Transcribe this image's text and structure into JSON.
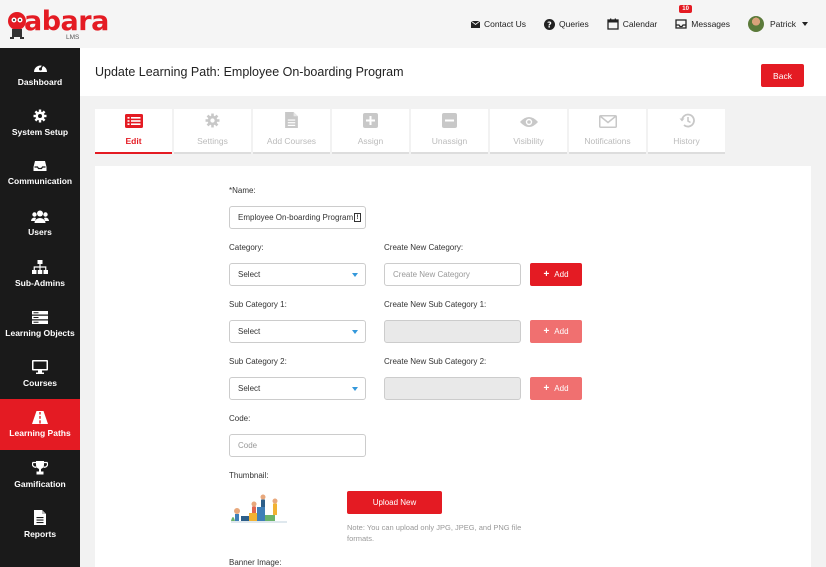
{
  "brand": {
    "name": "abara",
    "sub": "LMS"
  },
  "topnav": {
    "contact": "Contact Us",
    "queries": "Queries",
    "calendar": "Calendar",
    "messages": "Messages",
    "messages_count": "10",
    "user": "Patrick"
  },
  "sidebar": {
    "items": [
      {
        "label": "Dashboard",
        "icon": "dashboard-icon"
      },
      {
        "label": "System Setup",
        "icon": "gear-icon"
      },
      {
        "label": "Communication",
        "icon": "inbox-icon"
      },
      {
        "label": "Users",
        "icon": "users-icon"
      },
      {
        "label": "Sub-Admins",
        "icon": "sitemap-icon"
      },
      {
        "label": "Learning Objects",
        "icon": "server-icon"
      },
      {
        "label": "Courses",
        "icon": "monitor-icon"
      },
      {
        "label": "Learning Paths",
        "icon": "road-icon"
      },
      {
        "label": "Gamification",
        "icon": "trophy-icon"
      },
      {
        "label": "Reports",
        "icon": "file-icon"
      }
    ],
    "active": "Learning Paths"
  },
  "header": {
    "title": "Update Learning Path: Employee On-boarding Program",
    "back": "Back"
  },
  "tabs": [
    {
      "label": "Edit",
      "icon": "list-icon"
    },
    {
      "label": "Settings",
      "icon": "gear-icon"
    },
    {
      "label": "Add Courses",
      "icon": "file-icon"
    },
    {
      "label": "Assign",
      "icon": "plus-square-icon"
    },
    {
      "label": "Unassign",
      "icon": "minus-square-icon"
    },
    {
      "label": "Visibility",
      "icon": "eye-icon"
    },
    {
      "label": "Notifications",
      "icon": "envelope-icon"
    },
    {
      "label": "History",
      "icon": "history-icon"
    }
  ],
  "form": {
    "name_label": "*Name:",
    "name_value": "Employee On-boarding Program",
    "category_label": "Category:",
    "category_value": "Select",
    "new_category_label": "Create New Category:",
    "new_category_placeholder": "Create New Category",
    "add_label": "Add",
    "sub1_label": "Sub Category 1:",
    "sub1_value": "Select",
    "new_sub1_label": "Create New Sub Category 1:",
    "sub2_label": "Sub Category 2:",
    "sub2_value": "Select",
    "new_sub2_label": "Create New Sub Category 2:",
    "code_label": "Code:",
    "code_placeholder": "Code",
    "thumbnail_label": "Thumbnail:",
    "upload_label": "Upload New",
    "upload_note": "Note: You can upload only JPG, JPEG, and PNG file formats.",
    "banner_label": "Banner Image:"
  },
  "colors": {
    "accent": "#e41b23",
    "sidebar": "#1a1a1a"
  }
}
